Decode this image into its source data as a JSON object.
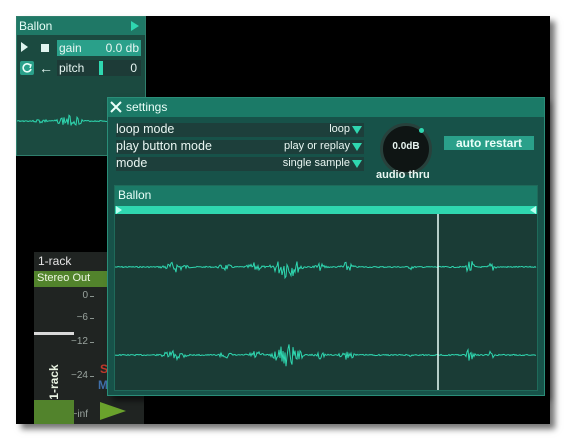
{
  "sampler": {
    "title": "Ballon",
    "gain_label": "gain",
    "gain_value": "0.0 db",
    "pitch_label": "pitch",
    "pitch_value": "0"
  },
  "rack": {
    "title": "1-rack",
    "output": "Stereo Out",
    "meter_ticks": [
      "0",
      "−6",
      "−12",
      "−24",
      "−inf"
    ],
    "vertical_label": "1-rack",
    "s_letter": "S",
    "m_letter": "M"
  },
  "settings": {
    "title": "settings",
    "rows": [
      {
        "label": "loop mode",
        "value": "loop"
      },
      {
        "label": "play button mode",
        "value": "play or replay"
      },
      {
        "label": "mode",
        "value": "single sample"
      }
    ],
    "knob_value": "0.0dB",
    "knob_label": "audio thru",
    "auto_restart": "auto restart",
    "waveform_title": "Ballon"
  },
  "colors": {
    "accent": "#2fd7b0",
    "panel": "#175249",
    "title_bar": "#1b7a67",
    "rack_green": "#52832c"
  }
}
